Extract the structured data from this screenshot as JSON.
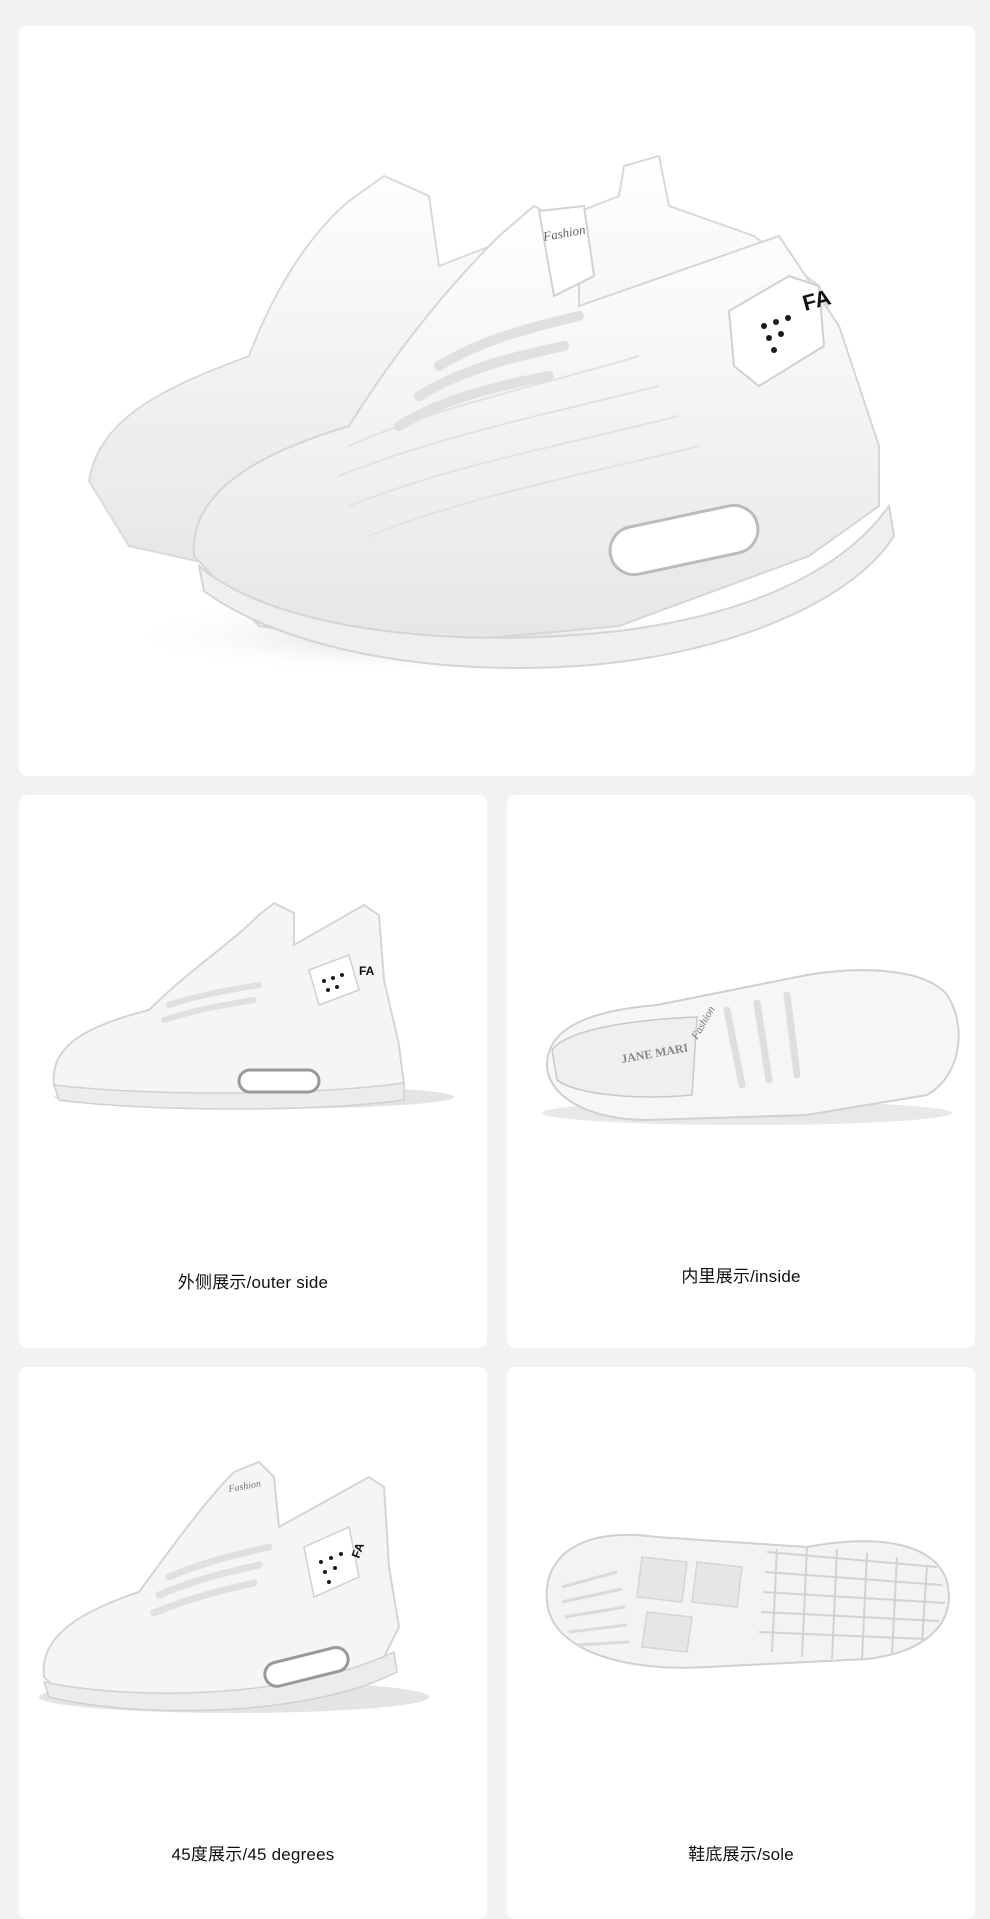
{
  "hero": {
    "logo_text": "FA",
    "tongue_text": "Fashion"
  },
  "panels": [
    {
      "caption": "外侧展示/outer side"
    },
    {
      "caption": "内里展示/inside",
      "insole_text": "JANE MARI"
    },
    {
      "caption": "45度展示/45 degrees"
    },
    {
      "caption": "鞋底展示/sole"
    }
  ],
  "colors": {
    "background": "#f2f2f2",
    "card": "#ffffff",
    "shoe": "#f4f4f4",
    "logo": "#111111"
  }
}
